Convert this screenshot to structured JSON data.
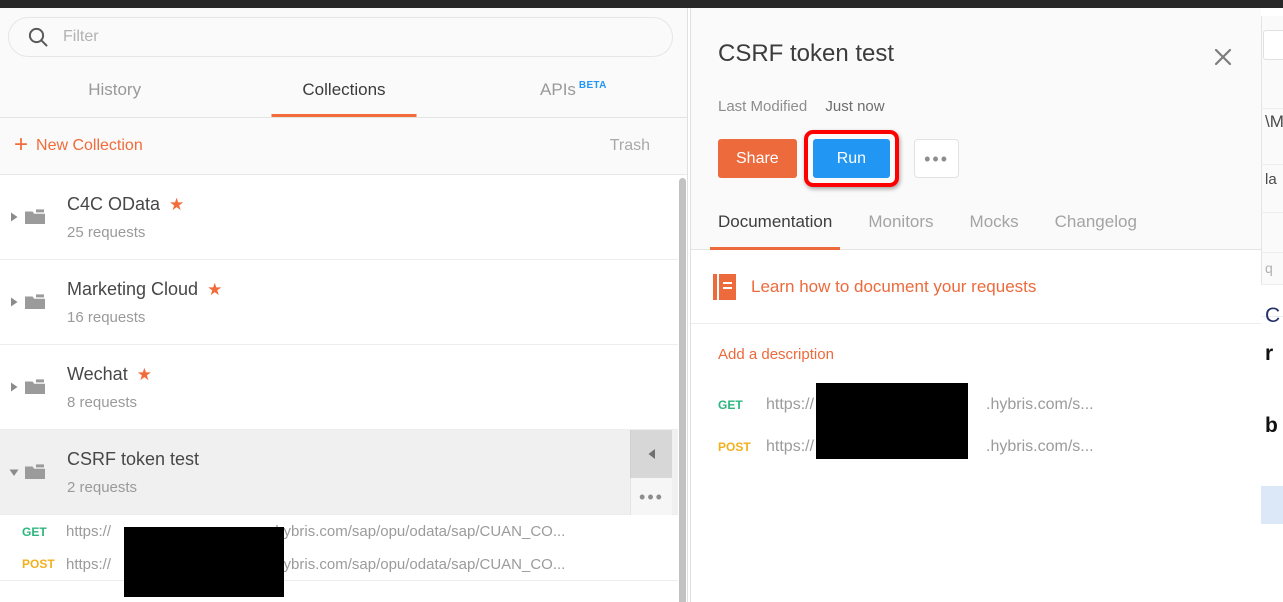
{
  "sidebar": {
    "filter": {
      "placeholder": "Filter",
      "value": "",
      "icon": "search-icon"
    },
    "tabs": [
      {
        "label": "History",
        "active": false
      },
      {
        "label": "Collections",
        "active": true
      },
      {
        "label": "APIs",
        "badge": "BETA",
        "active": false
      }
    ],
    "actions": {
      "new_collection": "New Collection",
      "trash": "Trash",
      "plus": "+"
    },
    "collections": [
      {
        "name": "C4C OData",
        "count": "25 requests",
        "starred": true,
        "expanded": false,
        "selected": false
      },
      {
        "name": "Marketing Cloud",
        "count": "16 requests",
        "starred": true,
        "expanded": false,
        "selected": false
      },
      {
        "name": "Wechat",
        "count": "8 requests",
        "starred": true,
        "expanded": false,
        "selected": false
      },
      {
        "name": "CSRF token test",
        "count": "2 requests",
        "starred": false,
        "expanded": true,
        "selected": true
      }
    ],
    "requests": [
      {
        "method": "GET",
        "url_prefix": "https://",
        "url_suffix": ".hybris.com/sap/opu/odata/sap/CUAN_CO..."
      },
      {
        "method": "POST",
        "url_prefix": "https://",
        "url_suffix": ".hybris.com/sap/opu/odata/sap/CUAN_CO..."
      }
    ],
    "row_controls": {
      "collapse": "collapse-arrow-icon",
      "more": "•••"
    }
  },
  "panel": {
    "title": "CSRF token test",
    "close": "✕",
    "meta_label": "Last Modified",
    "meta_value": "Just now",
    "buttons": {
      "share": "Share",
      "run": "Run",
      "more": "•••"
    },
    "highlight_color": "#ff0000",
    "run_color": "#2196f3",
    "share_color": "#ec6a3c",
    "tabs": [
      {
        "label": "Documentation",
        "active": true
      },
      {
        "label": "Monitors",
        "active": false
      },
      {
        "label": "Mocks",
        "active": false
      },
      {
        "label": "Changelog",
        "active": false
      }
    ],
    "documentation": {
      "learn_link": "Learn how to document your requests",
      "learn_icon": "book-icon",
      "add_description": "Add a description"
    },
    "requests": [
      {
        "method": "GET",
        "url_prefix": "https://",
        "url_suffix": ".hybris.com/s..."
      },
      {
        "method": "POST",
        "url_prefix": "https://",
        "url_suffix": ".hybris.com/s..."
      }
    ]
  },
  "background_sliver": {
    "fragments": [
      "\\M",
      "la",
      "q",
      "C",
      "r",
      "b"
    ]
  }
}
